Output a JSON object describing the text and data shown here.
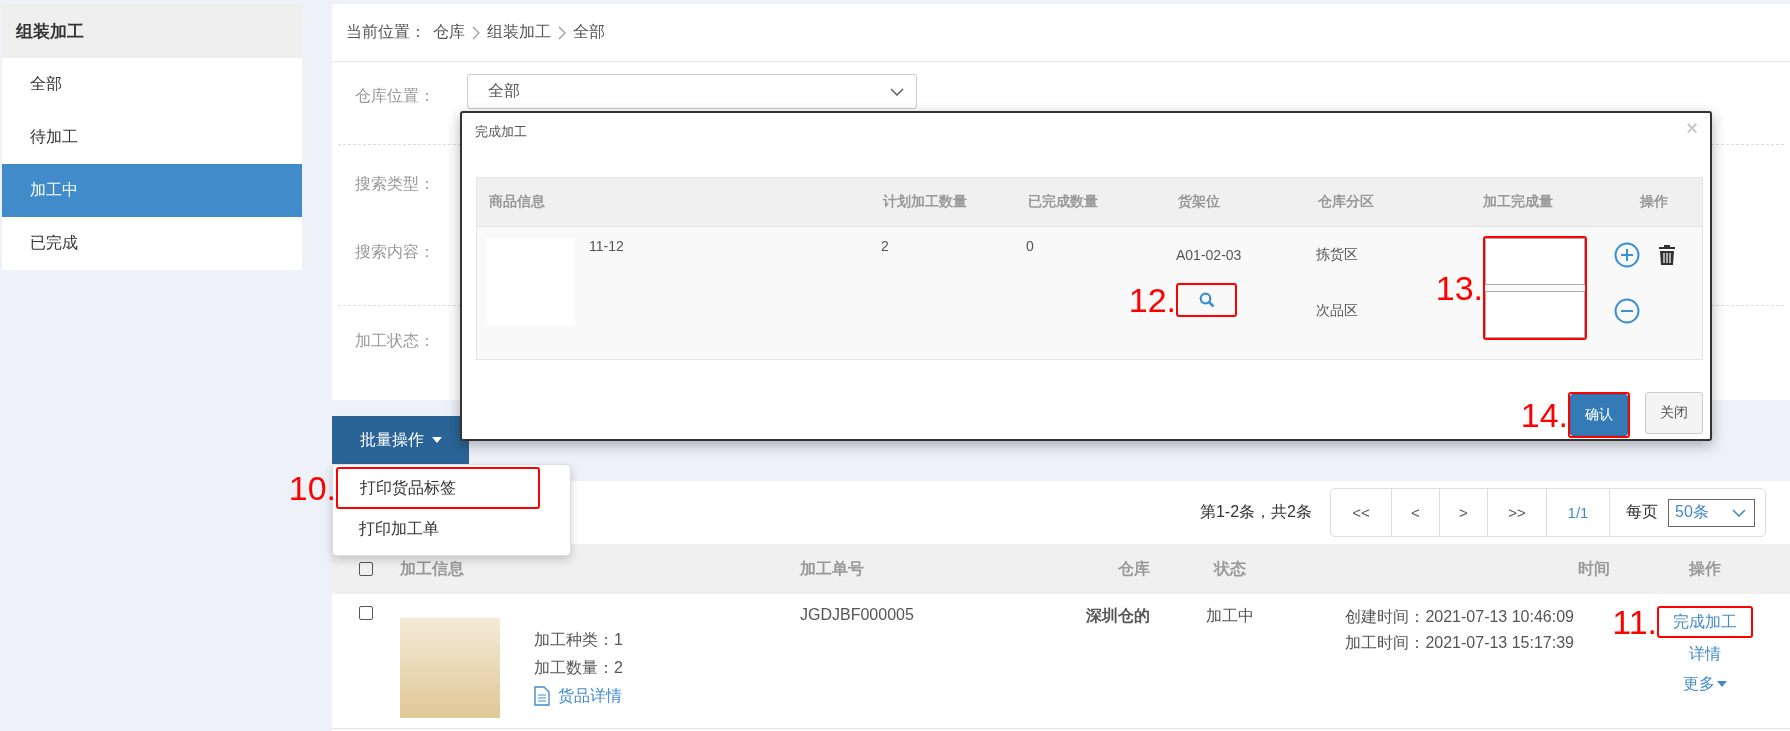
{
  "sidebar": {
    "title": "组装加工",
    "items": [
      {
        "label": "全部",
        "selected": false
      },
      {
        "label": "待加工",
        "selected": false
      },
      {
        "label": "加工中",
        "selected": true
      },
      {
        "label": "已完成",
        "selected": false
      }
    ]
  },
  "breadcrumb": {
    "prefix": "当前位置：",
    "items": [
      "仓库",
      "组装加工",
      "全部"
    ]
  },
  "filter_groups": [
    {
      "rows": [
        {
          "label": "仓库位置：",
          "kind": "select",
          "value": "全部"
        }
      ]
    },
    {
      "rows": [
        {
          "label": "搜索类型：",
          "kind": "label"
        },
        {
          "label": "搜索内容：",
          "kind": "label"
        }
      ]
    },
    {
      "rows": [
        {
          "label": "加工状态：",
          "kind": "label"
        }
      ]
    }
  ],
  "batch": {
    "label": "批量操作",
    "expanded": true,
    "menu": [
      {
        "label": "打印货品标签",
        "annotation": "10."
      },
      {
        "label": "打印加工单"
      }
    ]
  },
  "list": {
    "summary": "第1-2条，共2条",
    "pager": [
      "<<",
      "<",
      ">",
      ">>"
    ],
    "page": "1/1",
    "per_page_label": "每页",
    "per_page": "50条",
    "columns": [
      "加工信息",
      "加工单号",
      "仓库",
      "状态",
      "时间",
      "操作"
    ],
    "header_checked": false,
    "rows": [
      {
        "checked": false,
        "info": [
          "加工种类：1",
          "加工数量：2"
        ],
        "detail_link": "货品详情",
        "order_no": "JGDJBF000005",
        "warehouse": "深圳仓的",
        "status": "加工中",
        "times": [
          "创建时间：2021-07-13 10:46:09",
          "加工时间：2021-07-13 15:17:39"
        ],
        "actions": [
          {
            "label": "完成加工",
            "kind": "link",
            "annotation": "11."
          },
          {
            "label": "详情",
            "kind": "link"
          },
          {
            "label": "更多",
            "kind": "dropdown"
          }
        ]
      }
    ]
  },
  "modal": {
    "title": "完成加工",
    "close": "×",
    "columns": [
      "商品信息",
      "计划加工数量",
      "已完成数量",
      "货架位",
      "仓库分区",
      "加工完成量",
      "操作"
    ],
    "rows": [
      {
        "product": "11-12",
        "planned": "2",
        "done": "0",
        "shelf": "A01-02-03",
        "search_annotation": "12.",
        "qty_annotation": "13.",
        "zones": [
          {
            "name": "拣货区",
            "kind": "add"
          },
          {
            "name": "次品区",
            "kind": "remove"
          }
        ]
      }
    ],
    "buttons": [
      {
        "label": "确认",
        "kind": "primary",
        "annotation": "14."
      },
      {
        "label": "关闭",
        "kind": "default"
      }
    ]
  }
}
